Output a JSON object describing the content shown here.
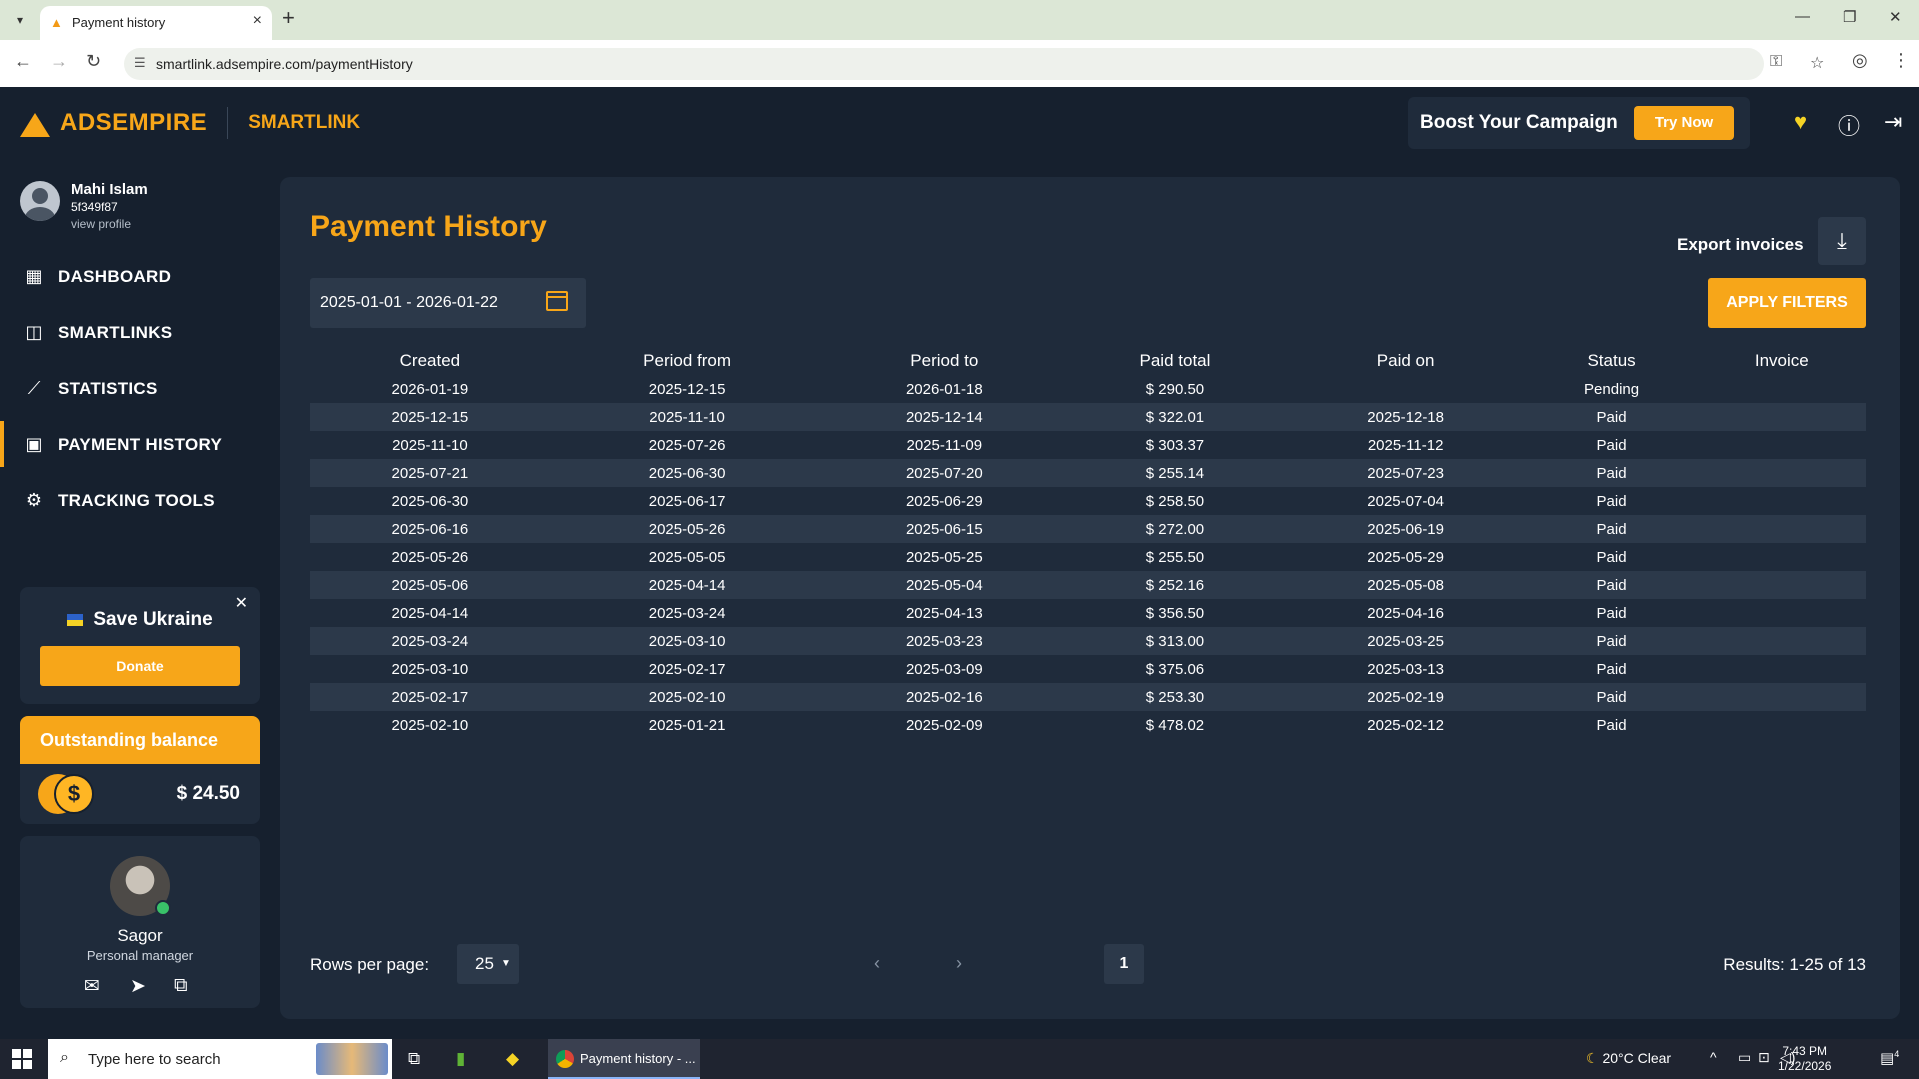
{
  "browser": {
    "tab_title": "Payment history",
    "url": "smartlink.adsempire.com/paymentHistory"
  },
  "header": {
    "logo_text": "ADSEMPIRE",
    "product": "SMARTLINK",
    "boost_label": "Boost Your Campaign",
    "try_now": "Try Now"
  },
  "user": {
    "name": "Mahi Islam",
    "id": "5f349f87",
    "profile_link": "view profile"
  },
  "nav": [
    {
      "label": "DASHBOARD",
      "icon": "grid-icon"
    },
    {
      "label": "SMARTLINKS",
      "icon": "link-icon"
    },
    {
      "label": "STATISTICS",
      "icon": "chart-icon"
    },
    {
      "label": "PAYMENT HISTORY",
      "icon": "wallet-icon",
      "active": true
    },
    {
      "label": "TRACKING TOOLS",
      "icon": "gear-icon"
    }
  ],
  "ukraine": {
    "title": "Save Ukraine",
    "donate": "Donate"
  },
  "balance": {
    "label": "Outstanding balance",
    "value": "$ 24.50"
  },
  "manager": {
    "name": "Sagor",
    "role": "Personal manager"
  },
  "page": {
    "title": "Payment History",
    "export_label": "Export invoices",
    "date_range": "2025-01-01 - 2026-01-22",
    "apply_label": "APPLY FILTERS"
  },
  "table": {
    "columns": [
      "Created",
      "Period from",
      "Period to",
      "Paid total",
      "Paid on",
      "Status",
      "Invoice"
    ],
    "rows": [
      [
        "2026-01-19",
        "2025-12-15",
        "2026-01-18",
        "$ 290.50",
        "",
        "Pending",
        ""
      ],
      [
        "2025-12-15",
        "2025-11-10",
        "2025-12-14",
        "$ 322.01",
        "2025-12-18",
        "Paid",
        ""
      ],
      [
        "2025-11-10",
        "2025-07-26",
        "2025-11-09",
        "$ 303.37",
        "2025-11-12",
        "Paid",
        ""
      ],
      [
        "2025-07-21",
        "2025-06-30",
        "2025-07-20",
        "$ 255.14",
        "2025-07-23",
        "Paid",
        ""
      ],
      [
        "2025-06-30",
        "2025-06-17",
        "2025-06-29",
        "$ 258.50",
        "2025-07-04",
        "Paid",
        ""
      ],
      [
        "2025-06-16",
        "2025-05-26",
        "2025-06-15",
        "$ 272.00",
        "2025-06-19",
        "Paid",
        ""
      ],
      [
        "2025-05-26",
        "2025-05-05",
        "2025-05-25",
        "$ 255.50",
        "2025-05-29",
        "Paid",
        ""
      ],
      [
        "2025-05-06",
        "2025-04-14",
        "2025-05-04",
        "$ 252.16",
        "2025-05-08",
        "Paid",
        ""
      ],
      [
        "2025-04-14",
        "2025-03-24",
        "2025-04-13",
        "$ 356.50",
        "2025-04-16",
        "Paid",
        ""
      ],
      [
        "2025-03-24",
        "2025-03-10",
        "2025-03-23",
        "$ 313.00",
        "2025-03-25",
        "Paid",
        ""
      ],
      [
        "2025-03-10",
        "2025-02-17",
        "2025-03-09",
        "$ 375.06",
        "2025-03-13",
        "Paid",
        ""
      ],
      [
        "2025-02-17",
        "2025-02-10",
        "2025-02-16",
        "$ 253.30",
        "2025-02-19",
        "Paid",
        ""
      ],
      [
        "2025-02-10",
        "2025-01-21",
        "2025-02-09",
        "$ 478.02",
        "2025-02-12",
        "Paid",
        ""
      ]
    ]
  },
  "pagination": {
    "rows_label": "Rows per page:",
    "rows_value": "25",
    "current_page": "1",
    "results": "Results: 1-25 of 13"
  },
  "taskbar": {
    "search_placeholder": "Type here to search",
    "app_title": "Payment history - ...",
    "weather": "20°C  Clear",
    "time": "7:43 PM",
    "date": "1/22/2026",
    "notifications": "4"
  },
  "colors": {
    "accent": "#f7a619",
    "background": "#16202e",
    "panel": "#1f2b3b",
    "stripe": "#2c394a"
  }
}
